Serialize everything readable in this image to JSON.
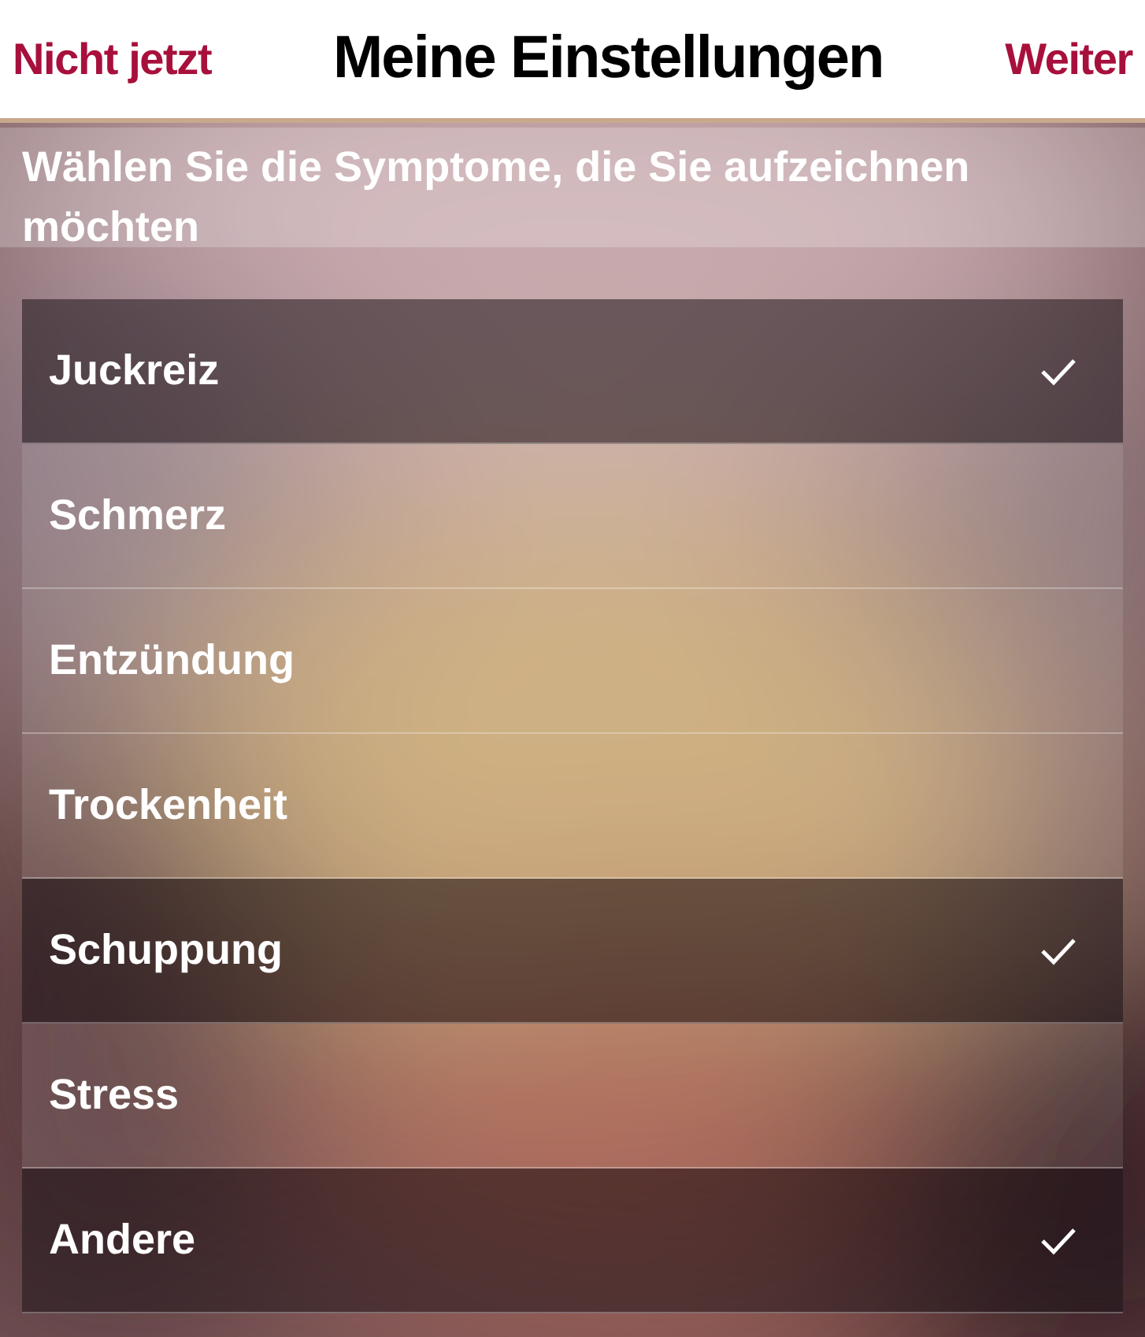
{
  "header": {
    "left_button": "Nicht jetzt",
    "title": "Meine Einstellungen",
    "right_button": "Weiter"
  },
  "instruction": "Wählen Sie die Symptome, die Sie aufzeichnen möchten",
  "symptoms": [
    {
      "label": "Juckreiz",
      "selected": true
    },
    {
      "label": "Schmerz",
      "selected": false
    },
    {
      "label": "Entzündung",
      "selected": false
    },
    {
      "label": "Trockenheit",
      "selected": false
    },
    {
      "label": "Schuppung",
      "selected": true
    },
    {
      "label": "Stress",
      "selected": false
    },
    {
      "label": "Andere",
      "selected": true
    }
  ]
}
